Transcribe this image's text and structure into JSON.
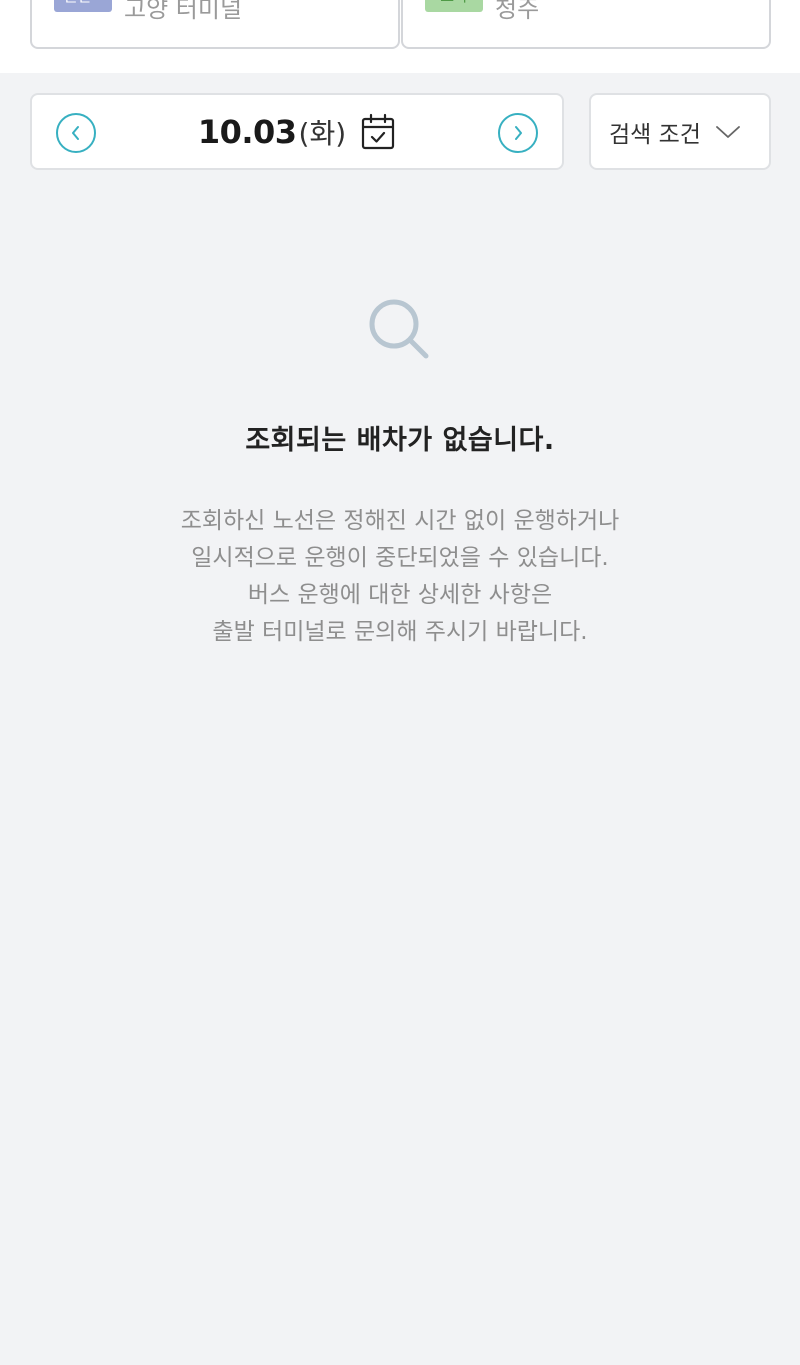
{
  "route": {
    "departure": {
      "badge": "출발",
      "name": "고양 터미널"
    },
    "arrival": {
      "badge": "도착",
      "name": "청주"
    }
  },
  "date_bar": {
    "date": "10.03",
    "weekday": "(화)"
  },
  "search_filter": {
    "label": "검색 조건"
  },
  "empty_state": {
    "title": "조회되는 배차가 없습니다.",
    "description": [
      "조회하신 노선은 정해진 시간 없이 운행하거나",
      "일시적으로 운행이 중단되었을 수 있습니다.",
      "버스 운행에 대한 상세한 사항은",
      "출발 터미널로 문의해 주시기 바랍니다."
    ]
  },
  "colors": {
    "accent": "#37b0c1",
    "background": "#f2f3f5",
    "muted_text": "#8e8e8e"
  }
}
